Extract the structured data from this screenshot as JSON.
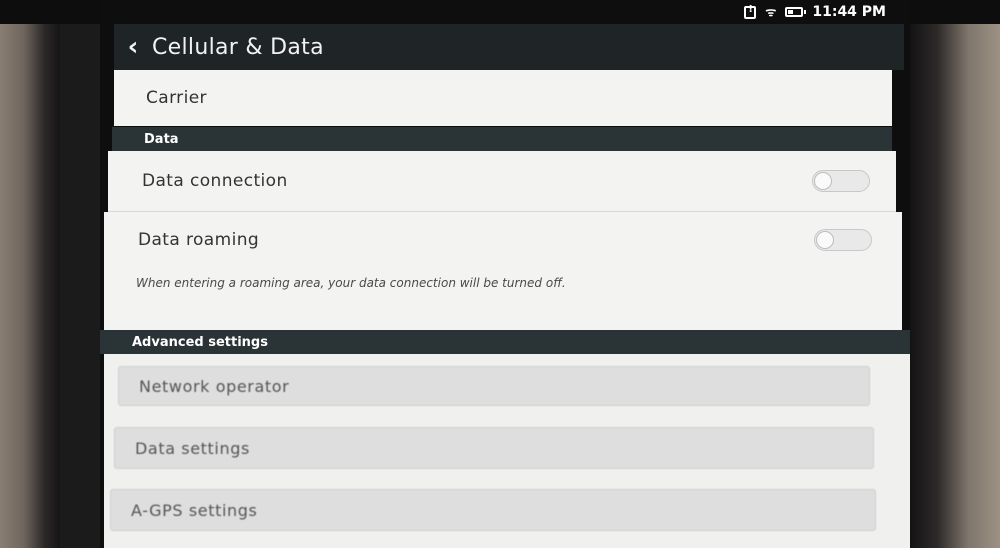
{
  "status_bar": {
    "time": "11:44 PM",
    "icons": [
      "sim-alert-icon",
      "wifi-icon",
      "battery-icon"
    ]
  },
  "header": {
    "back_icon": "chevron-left-icon",
    "title": "Cellular & Data"
  },
  "carrier": {
    "label": "Carrier"
  },
  "data_section": {
    "title": "Data",
    "data_connection": {
      "label": "Data connection",
      "enabled": false
    },
    "data_roaming": {
      "label": "Data roaming",
      "enabled": false,
      "note": "When entering a roaming area, your data connection will be turned off."
    }
  },
  "advanced_section": {
    "title": "Advanced settings",
    "items": [
      {
        "label": "Network operator"
      },
      {
        "label": "Data settings"
      },
      {
        "label": "A-GPS settings"
      }
    ]
  },
  "colors": {
    "header_bg": "#1f2426",
    "section_header_bg": "#2a3336",
    "list_bg": "#f3f3f2"
  }
}
